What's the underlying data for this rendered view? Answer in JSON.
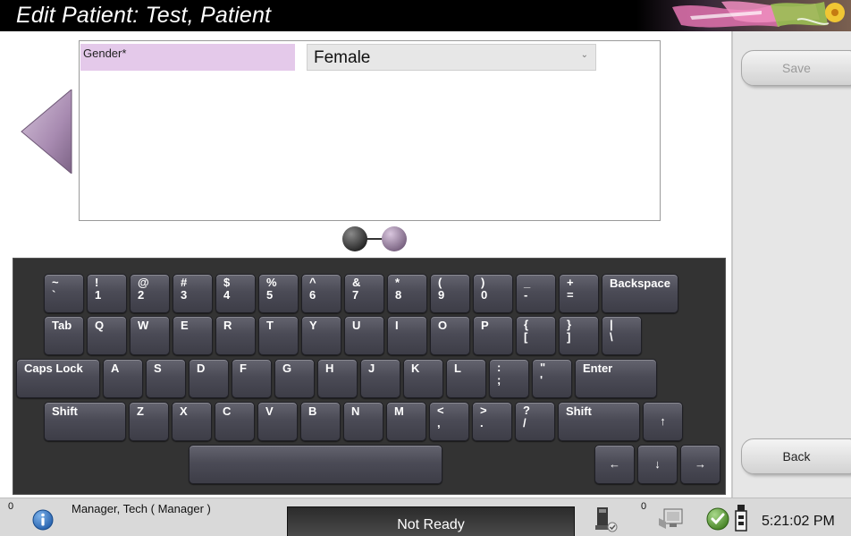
{
  "title": "Edit Patient: Test, Patient",
  "form": {
    "field_label": "Gender*",
    "field_value": "Female"
  },
  "side_buttons": {
    "save": "Save",
    "back": "Back"
  },
  "keyboard": {
    "rows": [
      [
        {
          "top": "~",
          "bottom": "`"
        },
        {
          "top": "!",
          "bottom": "1"
        },
        {
          "top": "@",
          "bottom": "2"
        },
        {
          "top": "#",
          "bottom": "3"
        },
        {
          "top": "$",
          "bottom": "4"
        },
        {
          "top": "%",
          "bottom": "5"
        },
        {
          "top": "^",
          "bottom": "6"
        },
        {
          "top": "&",
          "bottom": "7"
        },
        {
          "top": "*",
          "bottom": "8"
        },
        {
          "top": "(",
          "bottom": "9"
        },
        {
          "top": ")",
          "bottom": "0"
        },
        {
          "top": "_",
          "bottom": "-"
        },
        {
          "top": "+",
          "bottom": "="
        },
        {
          "label": "Backspace"
        }
      ],
      [
        {
          "label": "Tab"
        },
        {
          "label": "Q"
        },
        {
          "label": "W"
        },
        {
          "label": "E"
        },
        {
          "label": "R"
        },
        {
          "label": "T"
        },
        {
          "label": "Y"
        },
        {
          "label": "U"
        },
        {
          "label": "I"
        },
        {
          "label": "O"
        },
        {
          "label": "P"
        },
        {
          "top": "{",
          "bottom": "["
        },
        {
          "top": "}",
          "bottom": "]"
        },
        {
          "top": "|",
          "bottom": "\\"
        }
      ],
      [
        {
          "label": "Caps Lock"
        },
        {
          "label": "A"
        },
        {
          "label": "S"
        },
        {
          "label": "D"
        },
        {
          "label": "F"
        },
        {
          "label": "G"
        },
        {
          "label": "H"
        },
        {
          "label": "J"
        },
        {
          "label": "K"
        },
        {
          "label": "L"
        },
        {
          "top": ":",
          "bottom": ";"
        },
        {
          "top": "\"",
          "bottom": "'"
        },
        {
          "label": "Enter"
        }
      ],
      [
        {
          "label": "Shift"
        },
        {
          "label": "Z"
        },
        {
          "label": "X"
        },
        {
          "label": "C"
        },
        {
          "label": "V"
        },
        {
          "label": "B"
        },
        {
          "label": "N"
        },
        {
          "label": "M"
        },
        {
          "top": "<",
          "bottom": ","
        },
        {
          "top": ">",
          "bottom": "."
        },
        {
          "top": "?",
          "bottom": "/"
        },
        {
          "label": "Shift"
        },
        {
          "label": "↑"
        }
      ],
      [
        {
          "label": ""
        },
        {
          "label": "←"
        },
        {
          "label": "↓"
        },
        {
          "label": "→"
        }
      ]
    ]
  },
  "status": {
    "message_count": "0",
    "user": "Manager, Tech ( Manager )",
    "system_state": "Not Ready",
    "queue_count": "0",
    "clock": "5:21:02 PM"
  },
  "colors": {
    "title_bar": "#000000",
    "field_label_bg": "#e4c9ea",
    "arrow": "#b49bbb",
    "keyboard_bg": "#333333",
    "status_ok": "#5aa02c",
    "info_blue": "#2a6ab8"
  },
  "icons": {
    "prev": "left-arrow-icon",
    "info": "info-icon",
    "printer": "printer-icon",
    "monitor": "monitor-icon",
    "check": "check-icon",
    "usb": "usb-icon",
    "page_dots": "page-indicator-icon"
  }
}
